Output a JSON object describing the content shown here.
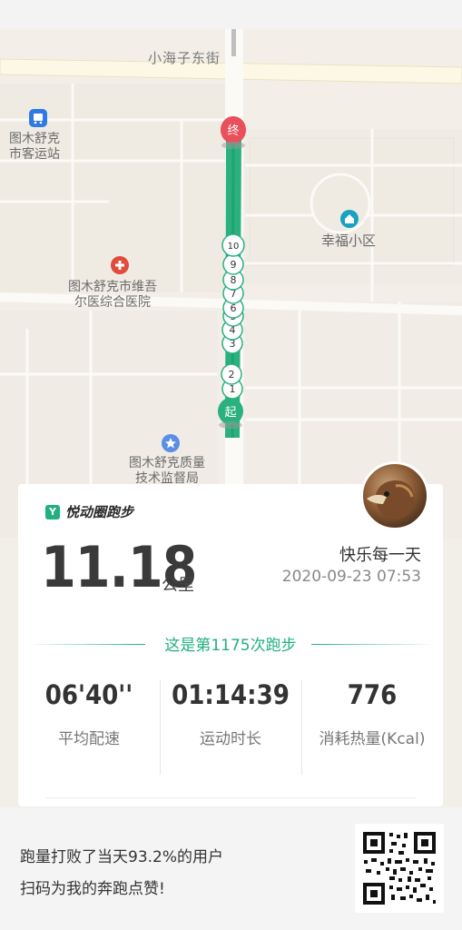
{
  "map": {
    "road_label": "小海子东街",
    "pois": [
      {
        "name": "图木舒克市客运站",
        "lines": [
          "图木舒克",
          "市客运站"
        ],
        "icon": "bus-icon",
        "color": "#2d7be0"
      },
      {
        "name": "幸福小区",
        "lines": [
          "幸福小区"
        ],
        "icon": "residential-icon",
        "color": "#1aa0c0"
      },
      {
        "name": "图木舒克市维吾尔医综合医院",
        "lines": [
          "图木舒克市维吾",
          "尔医综合医院"
        ],
        "icon": "hospital-icon",
        "color": "#e04b3a"
      },
      {
        "name": "图木舒克质量技术监督局",
        "lines": [
          "图木舒克质量",
          "技术监督局"
        ],
        "icon": "government-icon",
        "color": "#5b8ee6"
      }
    ],
    "route": {
      "start_label": "起",
      "end_label": "终",
      "km_markers": [
        "1",
        "2",
        "3",
        "4",
        "5",
        "6",
        "7",
        "8",
        "9",
        "10"
      ],
      "route_color": "#2bb07f",
      "end_color": "#e8505b"
    }
  },
  "card": {
    "brand": "悦动圈跑步",
    "brand_icon_text": "Y",
    "distance": "11.18",
    "unit": "公里",
    "username": "快乐每一天",
    "datetime": "2020-09-23 07:53",
    "run_count_text": "这是第1175次跑步",
    "stats": [
      {
        "value": "06'40''",
        "label": "平均配速"
      },
      {
        "value": "01:14:39",
        "label": "运动时长"
      },
      {
        "value": "776",
        "label": "消耗热量(Kcal)"
      }
    ]
  },
  "footer": {
    "line1": "跑量打败了当天93.2%的用户",
    "line2": "扫码为我的奔跑点赞!"
  },
  "colors": {
    "accent": "#21b07e"
  }
}
